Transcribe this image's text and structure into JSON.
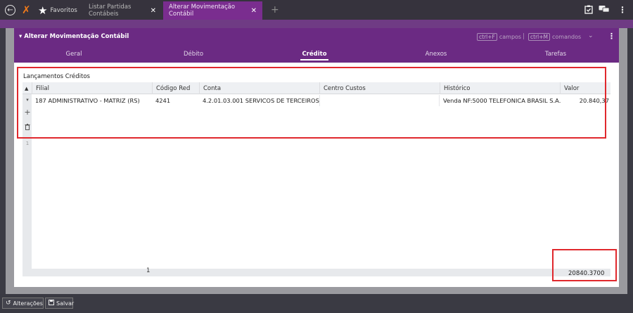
{
  "topbar": {
    "tabs": [
      {
        "label": "Favoritos"
      },
      {
        "label": "Listar Partidas Contábeis"
      },
      {
        "label": "Alterar Movimentação Contábil"
      }
    ],
    "close_glyph": "✕",
    "plus_glyph": "+"
  },
  "panel": {
    "title": "Alterar Movimentação Contábil",
    "shortcut_fields": {
      "key": "ctrl+F",
      "label": "campos"
    },
    "shortcut_separator": "|",
    "shortcut_commands": {
      "key": "ctrl+M",
      "label": "comandos"
    },
    "subtabs": [
      "Geral",
      "Débito",
      "Crédito",
      "Anexos",
      "Tarefas"
    ],
    "active_subtab": "Crédito"
  },
  "grid": {
    "section_title": "Lançamentos Créditos",
    "columns": [
      "Filial",
      "Código Red",
      "Conta",
      "Centro Custos",
      "Histórico",
      "Valor"
    ],
    "rows": [
      {
        "filial": "187 ADMINISTRATIVO - MATRIZ (RS)",
        "codigo_red": "4241",
        "conta": "4.2.01.03.001 SERVICOS DE TERCEIROS",
        "centro_custos": "",
        "historico": "Venda NF:5000 TELEFONICA BRASIL S.A.",
        "valor": "20.840,37"
      }
    ],
    "side_marker": "1",
    "footer_count": "1",
    "footer_total": "20840.3700"
  },
  "bottombar": {
    "changes_label": "Alterações",
    "save_label": "Salvar"
  },
  "colors": {
    "accent_purple": "#6b2a83",
    "active_tab": "#7a2d8f",
    "annotation_red": "#e0282d",
    "logo_orange": "#f07a1a"
  }
}
